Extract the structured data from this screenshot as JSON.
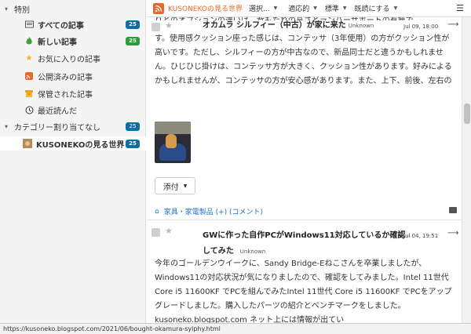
{
  "sidebar": {
    "section1_label": "特別",
    "items": [
      {
        "label": "すべての記事",
        "count": "25"
      },
      {
        "label": "新しい記事",
        "count": "25"
      },
      {
        "label": "お気に入りの記事"
      },
      {
        "label": "公開済みの記事"
      },
      {
        "label": "保管された記事"
      },
      {
        "label": "最近読んだ"
      }
    ],
    "section2_label": "カテゴリー割り当てなし",
    "section2_count": "25",
    "feed": {
      "label": "KUSONEKOの見る世界",
      "count": "25"
    }
  },
  "topbar": {
    "feed_title": "KUSONEKOの見る世界",
    "select_label": "選択...",
    "adaptive_label": "適応的",
    "standard_label": "標準",
    "mark_read_label": "既読にする"
  },
  "article1": {
    "title": "オカムラ シルフィー（中古）が家に来た",
    "author": "Unknown",
    "date": "Jul 09, 18:00",
    "top_text": "りとのオプションの違いは、背もたれの高さとランバーサポートの有無で",
    "body": "す。使用感クッション座った感じは、コンテッサ（3年使用）の方がクッション性が高いです。ただし、シルフィーの方が中古なので、新品同士だと違うかもしれません。ひじひじ掛けは、コンテッサ方が大きく、クッション性があります。好みによるかもしれませんが、コンテッサの方が安心感があります。また、上下、前後、左右の",
    "attach_label": "添付",
    "tags": "家具・家電製品 (+) (コメント)"
  },
  "article2": {
    "title": "GWに作った自作PCがWindows11対応しているか確認してみた",
    "author": "Unknown",
    "date": "Jul 04, 19:51",
    "body": "今年のゴールデンウイークに、Sandy Bridge-Eねこさんを卒業しましたが、Windows11の対応状況が気になりましたので、確認をしてみました。Intel 11世代 Core i5 11600KF でPCを組んでみたIntel 11世代 Core i5 11600KF でPCをアップグレードしました。購入したパーツの紹介とベンチマークをしました。kusoneko.blogspot.com ネット上には情報が出てい"
  },
  "status_url": "https://kusoneko.blogspot.com/2021/06/bought-okamura-sylphy.html",
  "colors": {
    "accent": "#e4692d",
    "badge": "#0b6fa4",
    "badge_new": "#2d9a3d",
    "link": "#1e6fc9"
  }
}
